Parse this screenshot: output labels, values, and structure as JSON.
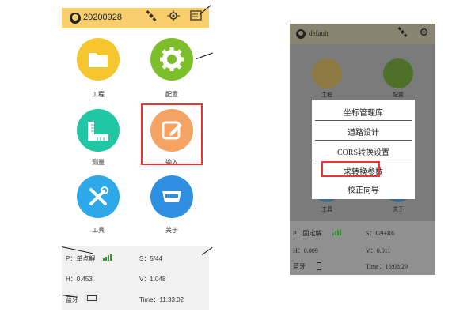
{
  "left": {
    "header": {
      "title": "20200928"
    },
    "menu": [
      {
        "label": "工程",
        "color": "#f6c62e",
        "icon": "folder-icon"
      },
      {
        "label": "配置",
        "color": "#7cbf2a",
        "icon": "gear-icon"
      },
      {
        "label": "测量",
        "color": "#21c7a2",
        "icon": "ruler-icon"
      },
      {
        "label": "输入",
        "color": "#f4a362",
        "icon": "edit-icon"
      },
      {
        "label": "工具",
        "color": "#2da8e8",
        "icon": "tools-icon"
      },
      {
        "label": "关于",
        "color": "#2e8fe0",
        "icon": "device-icon"
      }
    ],
    "status": {
      "p": "P：单点解",
      "s": "S：5/44",
      "h": "H：0.453",
      "v": "V：1.048",
      "bt": "蓝牙",
      "time": "Time：11:33:02"
    }
  },
  "right": {
    "header": {
      "title": "default"
    },
    "bg_labels": [
      "工程",
      "配置",
      "工具",
      "关于"
    ],
    "popup": [
      "坐标管理库",
      "道路设计",
      "CORS转换设置",
      "求转换参数",
      "校正向导"
    ],
    "status": {
      "p": "P：固定解",
      "s": "S：G9+R6",
      "h": "H：0.009",
      "v": "V：0.011",
      "bt": "蓝牙",
      "time": "Time：16:08:29"
    }
  },
  "colors": {
    "header": "#f8cf6c",
    "highlight": "#e33333"
  }
}
